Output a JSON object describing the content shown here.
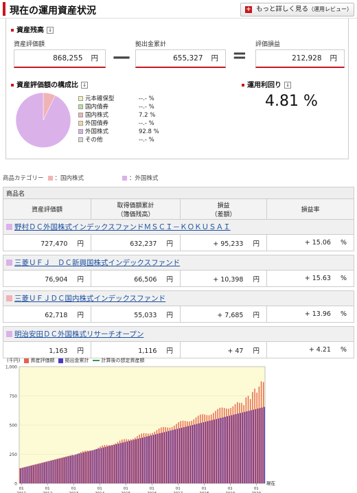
{
  "header": {
    "title": "現在の運用資産状況",
    "more_button": "もっと詳しく見る",
    "more_button_sub": "（運用レビュー）"
  },
  "balance": {
    "section_title": "資産残高",
    "asset_label": "資産評価額",
    "asset_value": "868,255",
    "contrib_label": "拠出金累計",
    "contrib_value": "655,327",
    "gain_label": "評価損益",
    "gain_value": "212,928",
    "unit": "円",
    "minus": "—",
    "equals": "="
  },
  "composition": {
    "section_title": "資産評価額の構成比",
    "items": [
      {
        "label": "元本確保型",
        "pct": "--.-  %",
        "color": "#f2f2b0"
      },
      {
        "label": "国内債券",
        "pct": "--.-  %",
        "color": "#b5e3a0"
      },
      {
        "label": "国内株式",
        "pct": "7.2  %",
        "color": "#f2b3b6"
      },
      {
        "label": "外国債券",
        "pct": "--.-  %",
        "color": "#f6d89a"
      },
      {
        "label": "外国株式",
        "pct": "92.8  %",
        "color": "#dbb1ea"
      },
      {
        "label": "その他",
        "pct": "--.-  %",
        "color": "#d8d8d8"
      }
    ],
    "pie": {
      "domestic_stock": 7.2,
      "foreign_stock": 92.8
    }
  },
  "return": {
    "section_title": "運用利回り",
    "value": "4.81  %"
  },
  "category": {
    "label": "商品カテゴリー",
    "items": [
      {
        "label": "：国内株式",
        "color": "#f2b3b6"
      },
      {
        "label": "：外国株式",
        "color": "#dbb1ea"
      }
    ]
  },
  "table": {
    "product_header": "商品名",
    "col1": "資産評価額",
    "col2a": "取得価額累計",
    "col2b": "（簿価残高）",
    "col3a": "損益",
    "col3b": "（差額）",
    "col4": "損益率",
    "unit": "円",
    "pct": "%",
    "funds": [
      {
        "name": "野村ＤＣ外国株式インデックスファンドＭＳＣＩ－ＫＯＫＵＳＡＩ",
        "color": "#dbb1ea",
        "v1": "727,470",
        "v2": "632,237",
        "v3": "+ 95,233",
        "v4": "+ 15.06"
      },
      {
        "name": "三菱ＵＦＪ　ＤＣ新興国株式インデックスファンド",
        "color": "#dbb1ea",
        "v1": "76,904",
        "v2": "66,506",
        "v3": "+ 10,398",
        "v4": "+ 15.63"
      },
      {
        "name": "三菱ＵＦＪＤＣ国内株式インデックスファンド",
        "color": "#f2b3b6",
        "v1": "62,718",
        "v2": "55,033",
        "v3": "+ 7,685",
        "v4": "+ 13.96"
      },
      {
        "name": "明治安田ＤＣ外国株式リサーチオープン",
        "color": "#dbb1ea",
        "v1": "1,163",
        "v2": "1,116",
        "v3": "+ 47",
        "v4": "+ 4.21"
      }
    ]
  },
  "chart_data": {
    "type": "bar",
    "unit_label": "(千円)",
    "legend": [
      "資産評価額",
      "拠出金累計",
      "計算後の想定資産額"
    ],
    "colors": {
      "asset": "#e8624a",
      "contrib": "#4b3bbf",
      "assumed": "#2a9a4a",
      "bg": "#fdfbd6"
    },
    "ylim": [
      0,
      1000
    ],
    "yticks": [
      "0",
      "250",
      "500",
      "750",
      "1,000"
    ],
    "xticks": [
      {
        "m": "01",
        "y": "2011"
      },
      {
        "m": "01",
        "y": "2012"
      },
      {
        "m": "01",
        "y": "2013"
      },
      {
        "m": "01",
        "y": "2014"
      },
      {
        "m": "01",
        "y": "2015"
      },
      {
        "m": "01",
        "y": "2016"
      },
      {
        "m": "01",
        "y": "2017"
      },
      {
        "m": "01",
        "y": "2018"
      },
      {
        "m": "01",
        "y": "2019"
      },
      {
        "m": "01",
        "y": "2020"
      }
    ],
    "xend_label": "現在",
    "series": [
      {
        "name": "資産評価額",
        "start": 135,
        "end": 868
      },
      {
        "name": "拠出金累計",
        "start": 130,
        "end": 655
      }
    ],
    "n_months": 113
  }
}
